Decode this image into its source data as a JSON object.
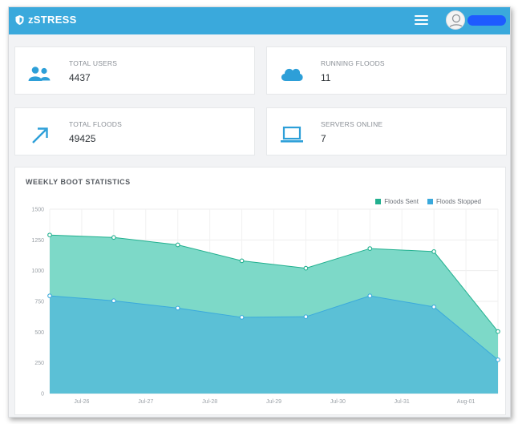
{
  "topbar": {
    "brand": "zSTRESS",
    "brand_icon": "shield-icon",
    "menu_icon": "hamburger-icon",
    "avatar_icon": "user-avatar-icon",
    "color": "#3aa9dc"
  },
  "stats": [
    {
      "label": "TOTAL USERS",
      "value": "4437",
      "icon": "users-icon"
    },
    {
      "label": "RUNNING FLOODS",
      "value": "11",
      "icon": "cloud-icon"
    },
    {
      "label": "TOTAL FLOODS",
      "value": "49425",
      "icon": "trending-arrow-icon"
    },
    {
      "label": "SERVERS ONLINE",
      "value": "7",
      "icon": "laptop-icon"
    }
  ],
  "chart_panel": {
    "title": "WEEKLY BOOT STATISTICS"
  },
  "chart_data": {
    "type": "area",
    "title": "WEEKLY BOOT STATISTICS",
    "x": [
      "Jul-26",
      "Jul-27",
      "Jul-28",
      "Jul-29",
      "Jul-30",
      "Jul-31",
      "Aug-01"
    ],
    "x_point_labels": [
      "",
      "Jul-26",
      "",
      "Jul-27",
      "",
      "Jul-28",
      "",
      "Jul-29",
      "",
      "Jul-30",
      "",
      "Jul-31",
      "",
      "Aug-01",
      ""
    ],
    "yticks": [
      0,
      250,
      500,
      750,
      1000,
      1250,
      1500
    ],
    "ylim": [
      0,
      1500
    ],
    "grid": true,
    "legend_position": "top-right",
    "series": [
      {
        "name": "Floods Sent",
        "color": "#7dd9c8",
        "stroke": "#22b08f",
        "values": [
          1290,
          1270,
          1210,
          1080,
          1020,
          1180,
          1155,
          505
        ]
      },
      {
        "name": "Floods Stopped",
        "color": "#5bc0d6",
        "stroke": "#3aa9dc",
        "values": [
          795,
          755,
          695,
          620,
          625,
          795,
          705,
          275
        ]
      }
    ]
  }
}
